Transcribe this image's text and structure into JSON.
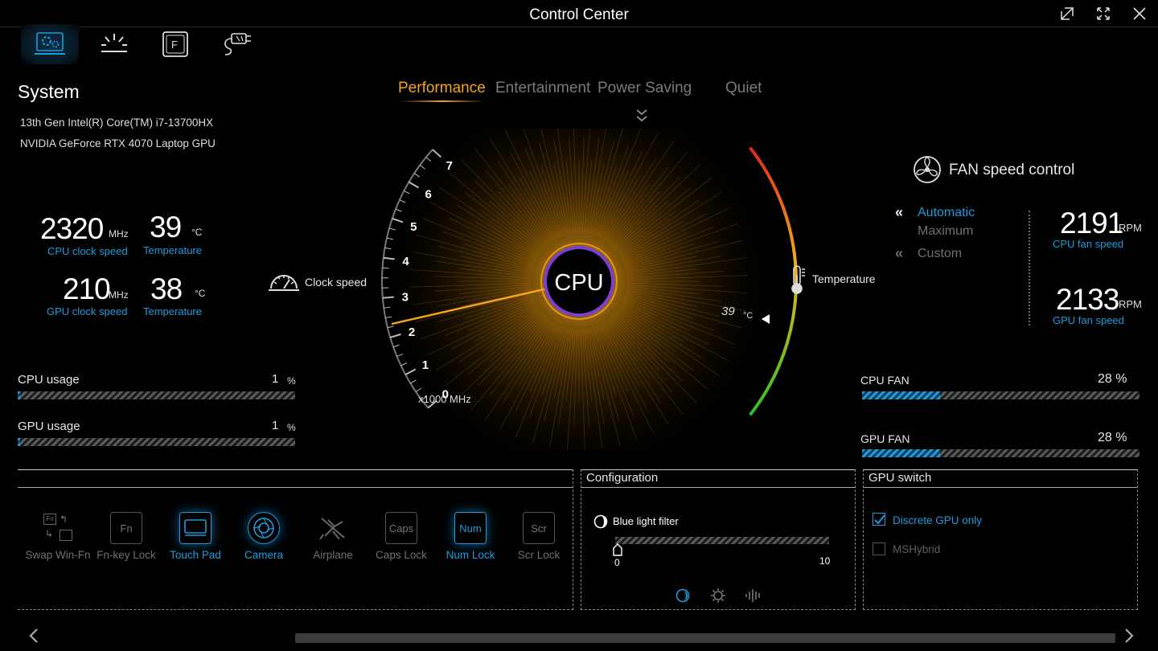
{
  "window": {
    "title": "Control Center"
  },
  "toolbar": {
    "icons": [
      "settings-laptop-icon",
      "lighting-icon",
      "function-key-icon",
      "power-plug-icon"
    ]
  },
  "system": {
    "title": "System",
    "cpu_name": "13th Gen Intel(R) Core(TM) i7-13700HX",
    "gpu_name": "NVIDIA GeForce RTX 4070 Laptop GPU",
    "cpu_clock": {
      "value": "2320",
      "unit": "MHz",
      "label": "CPU clock speed"
    },
    "cpu_temp": {
      "value": "39",
      "unit": "°C",
      "label": "Temperature"
    },
    "gpu_clock": {
      "value": "210",
      "unit": "MHz",
      "label": "GPU clock speed"
    },
    "gpu_temp": {
      "value": "38",
      "unit": "°C",
      "label": "Temperature"
    },
    "cpu_usage": {
      "label": "CPU usage",
      "value": "1",
      "unit": "%",
      "percent": 1
    },
    "gpu_usage": {
      "label": "GPU usage",
      "value": "1",
      "unit": "%",
      "percent": 1
    }
  },
  "modes": {
    "items": [
      "Performance",
      "Entertainment",
      "Power Saving",
      "Quiet"
    ],
    "active": "Performance"
  },
  "gauge": {
    "center_label": "CPU",
    "clock_label": "Clock speed",
    "temp_label": "Temperature",
    "scale_unit": "x1000 MHz",
    "ticks": [
      "0",
      "1",
      "2",
      "3",
      "4",
      "5",
      "6",
      "7"
    ],
    "clock_value_ghz": 2.32,
    "temp_value": "39",
    "temp_unit": "°C",
    "colors": {
      "needle": "#f3a51b",
      "ring": "#7a3fd1",
      "hot": "#e0281e",
      "cool": "#2fbf2a"
    }
  },
  "fan": {
    "title": "FAN speed control",
    "options": [
      "Automatic",
      "Maximum",
      "Custom"
    ],
    "selected": "Automatic",
    "cpu_rpm": {
      "value": "2191",
      "unit": "RPM",
      "label": "CPU fan speed"
    },
    "gpu_rpm": {
      "value": "2133",
      "unit": "RPM",
      "label": "GPU fan speed"
    },
    "cpu_fan": {
      "label": "CPU FAN",
      "value": "28 %",
      "percent": 28
    },
    "gpu_fan": {
      "label": "GPU FAN",
      "value": "28 %",
      "percent": 28
    }
  },
  "hotkeys": {
    "items": [
      {
        "label": "Swap Win-Fn",
        "key": "Fn",
        "on": false
      },
      {
        "label": "Fn-key Lock",
        "key": "Fn",
        "on": false
      },
      {
        "label": "Touch Pad",
        "key": "",
        "on": true
      },
      {
        "label": "Camera",
        "key": "",
        "on": true
      },
      {
        "label": "Airplane",
        "key": "",
        "on": false
      },
      {
        "label": "Caps Lock",
        "key": "Caps",
        "on": false
      },
      {
        "label": "Num Lock",
        "key": "Num",
        "on": true
      },
      {
        "label": "Scr Lock",
        "key": "Scr",
        "on": false
      }
    ]
  },
  "configuration": {
    "title": "Configuration",
    "blue_light": {
      "label": "Blue light filter",
      "min": "0",
      "max": "10",
      "value": 0
    }
  },
  "gpu_switch": {
    "title": "GPU switch",
    "options": [
      {
        "label": "Discrete GPU only",
        "checked": true
      },
      {
        "label": "MSHybrid",
        "checked": false
      }
    ]
  },
  "accent": "#1e9bdc"
}
